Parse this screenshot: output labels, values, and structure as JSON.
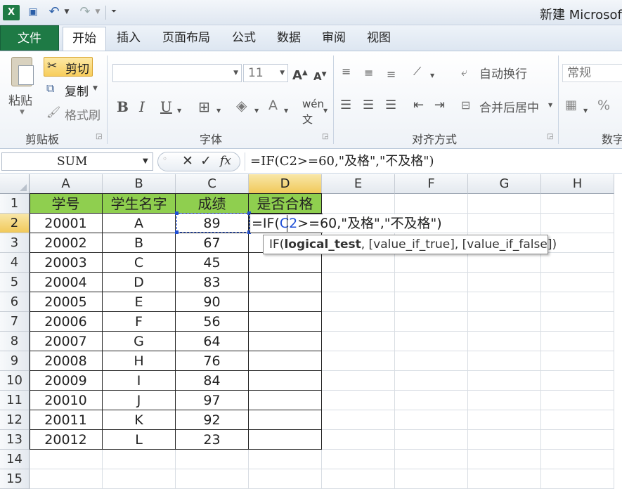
{
  "title_bar": {
    "doc_title": "新建 Microsof"
  },
  "tabs": [
    {
      "label": "文件"
    },
    {
      "label": "开始"
    },
    {
      "label": "插入"
    },
    {
      "label": "页面布局"
    },
    {
      "label": "公式"
    },
    {
      "label": "数据"
    },
    {
      "label": "审阅"
    },
    {
      "label": "视图"
    }
  ],
  "ribbon": {
    "clipboard": {
      "paste": "粘贴",
      "cut": "剪切",
      "copy": "复制",
      "format_painter": "格式刷",
      "group_label": "剪贴板"
    },
    "font": {
      "font_name": "",
      "font_size": "11",
      "group_label": "字体"
    },
    "alignment": {
      "wrap_text": "自动换行",
      "merge_center": "合并后居中",
      "group_label": "对齐方式"
    },
    "number": {
      "format": "常规",
      "group_label": "数字"
    }
  },
  "formula_bar": {
    "name_box": "SUM",
    "formula": "=IF(C2>=60,\"及格\",\"不及格\")"
  },
  "columns": [
    "A",
    "B",
    "C",
    "D",
    "E",
    "F",
    "G",
    "H"
  ],
  "rows": [
    "1",
    "2",
    "3",
    "4",
    "5",
    "6",
    "7",
    "8",
    "9",
    "10",
    "11",
    "12",
    "13",
    "14",
    "15"
  ],
  "table": {
    "headers": [
      "学号",
      "学生名字",
      "成绩",
      "是否合格"
    ],
    "data": [
      [
        "20001",
        "A",
        "89"
      ],
      [
        "20002",
        "B",
        "67"
      ],
      [
        "20003",
        "C",
        "45"
      ],
      [
        "20004",
        "D",
        "83"
      ],
      [
        "20005",
        "E",
        "90"
      ],
      [
        "20006",
        "F",
        "56"
      ],
      [
        "20007",
        "G",
        "64"
      ],
      [
        "20008",
        "H",
        "76"
      ],
      [
        "20009",
        "I",
        "84"
      ],
      [
        "20010",
        "J",
        "97"
      ],
      [
        "20011",
        "K",
        "92"
      ],
      [
        "20012",
        "L",
        "23"
      ]
    ]
  },
  "editing": {
    "prefix": "=IF(",
    "ref": "C2",
    "suffix": ">=60,\"及格\",\"不及格\")"
  },
  "tooltip": {
    "func": "IF(",
    "arg1": "logical_test",
    "rest": ", [value_if_true], [value_if_false])"
  },
  "colors": {
    "header_fill": "#8fcf4f",
    "file_tab": "#1e7a45",
    "selection_blue": "#1f4fd6"
  }
}
